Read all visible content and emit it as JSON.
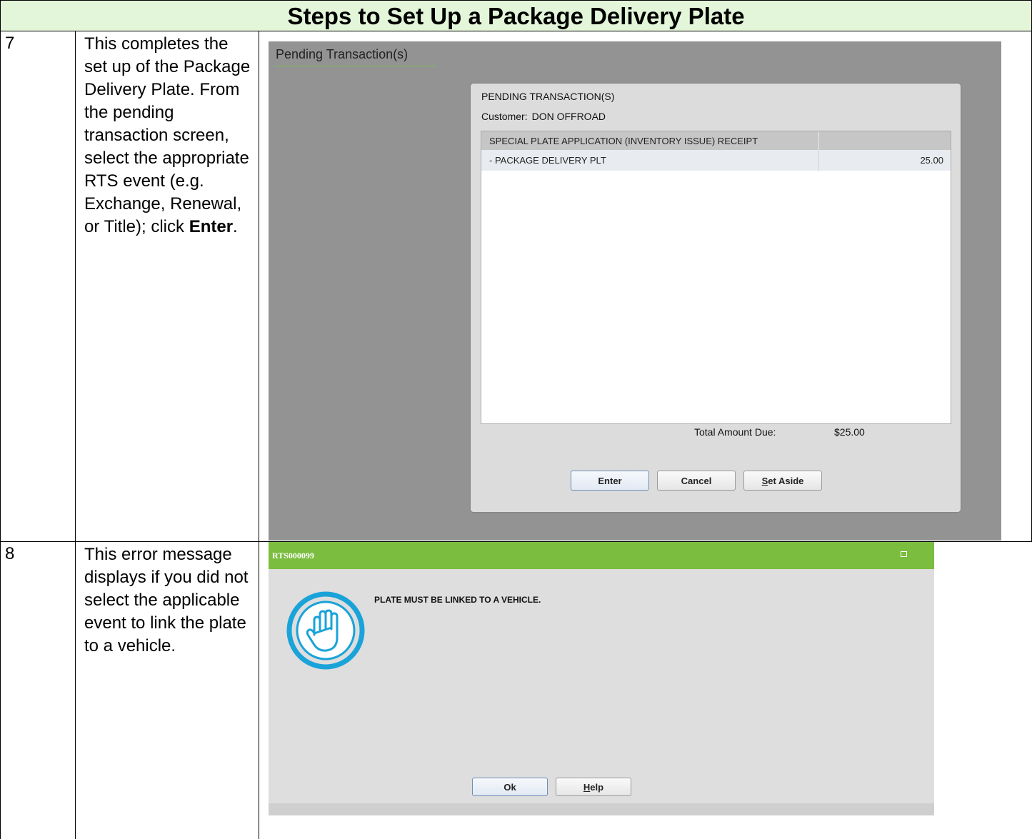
{
  "document": {
    "title": "Steps to Set Up a Package Delivery Plate",
    "steps": [
      {
        "number": "7",
        "text_before": "This completes the set up of the Package Delivery Plate. From the pending transaction screen, select the appropriate RTS event (e.g. Exchange, Renewal, or Title); click ",
        "text_bold": "Enter",
        "text_after": "."
      },
      {
        "number": "8",
        "text": "This error message displays if you did not select the applicable event to link the plate to a vehicle."
      }
    ]
  },
  "pending_screen": {
    "page_title": "Pending Transaction(s)",
    "dialog_heading": "PENDING TRANSACTION(S)",
    "customer_label": "Customer:",
    "customer_name": "DON OFFROAD",
    "list_header": "SPECIAL PLATE APPLICATION (INVENTORY ISSUE) RECEIPT",
    "rows": [
      {
        "description": "- PACKAGE DELIVERY PLT",
        "amount": "25.00"
      }
    ],
    "total_label": "Total Amount Due:",
    "total_value": "$25.00",
    "buttons": {
      "enter": "Enter",
      "cancel": "Cancel",
      "set_aside_underlined": "S",
      "set_aside_rest": "et Aside"
    }
  },
  "error_dialog": {
    "code": "RTS000099",
    "message": "PLATE MUST BE LINKED TO A VEHICLE.",
    "icon": "hand-stop-icon",
    "buttons": {
      "ok": "Ok",
      "help_underlined": "H",
      "help_rest": "elp"
    }
  },
  "colors": {
    "title_background": "#e3f6d9",
    "error_bar": "#7bbd3f",
    "icon_blue": "#1aa3d9",
    "screen_gray": "#939393"
  }
}
